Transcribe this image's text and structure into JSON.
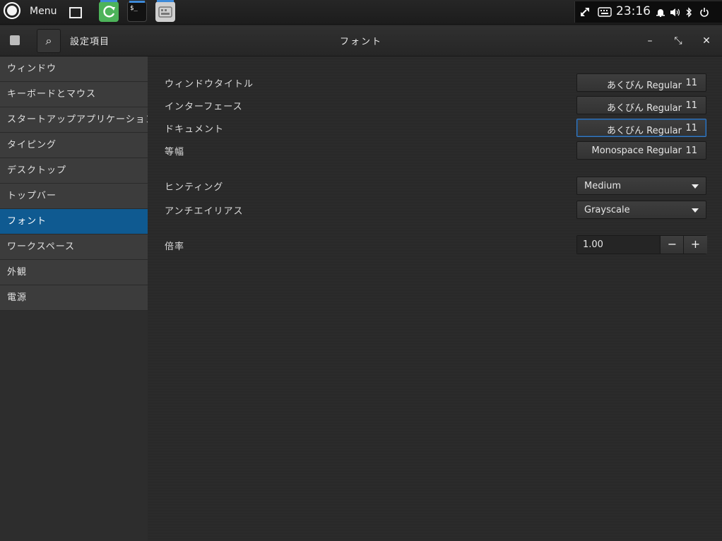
{
  "panel": {
    "menu_label": "Menu",
    "clock": "23:16",
    "tray_icons": [
      "transfer-icon",
      "keyboard-icon",
      "bell-icon",
      "volume-icon",
      "bluetooth-icon",
      "power-icon"
    ]
  },
  "titlebar": {
    "sidebar_title": "設定項目",
    "page_title": "フォント",
    "minimize": "–",
    "maximize": "⤡",
    "close": "✕",
    "search_icon": "⌕"
  },
  "sidebar": {
    "items": [
      {
        "label": "ウィンドウ"
      },
      {
        "label": "キーボードとマウス"
      },
      {
        "label": "スタートアップアプリケーション"
      },
      {
        "label": "タイピング"
      },
      {
        "label": "デスクトップ"
      },
      {
        "label": "トップバー"
      },
      {
        "label": "フォント"
      },
      {
        "label": "ワークスペース"
      },
      {
        "label": "外観"
      },
      {
        "label": "電源"
      }
    ],
    "selected_index": 6
  },
  "fonts": {
    "window_title": {
      "label": "ウィンドウタイトル",
      "font": "あくびん Regular",
      "size": "11"
    },
    "interface": {
      "label": "インターフェース",
      "font": "あくびん Regular",
      "size": "11"
    },
    "document": {
      "label": "ドキュメント",
      "font": "あくびん Regular",
      "size": "11"
    },
    "monospace": {
      "label": "等幅",
      "font": "Monospace Regular",
      "size": "11"
    }
  },
  "rendering": {
    "hinting": {
      "label": "ヒンティング",
      "value": "Medium"
    },
    "antialiasing": {
      "label": "アンチエイリアス",
      "value": "Grayscale"
    }
  },
  "scaling": {
    "label": "倍率",
    "value": "1.00",
    "minus": "−",
    "plus": "+"
  },
  "colors": {
    "accent": "#0f5a91",
    "focus": "#3c7ac0",
    "updater": "#4db35a"
  }
}
